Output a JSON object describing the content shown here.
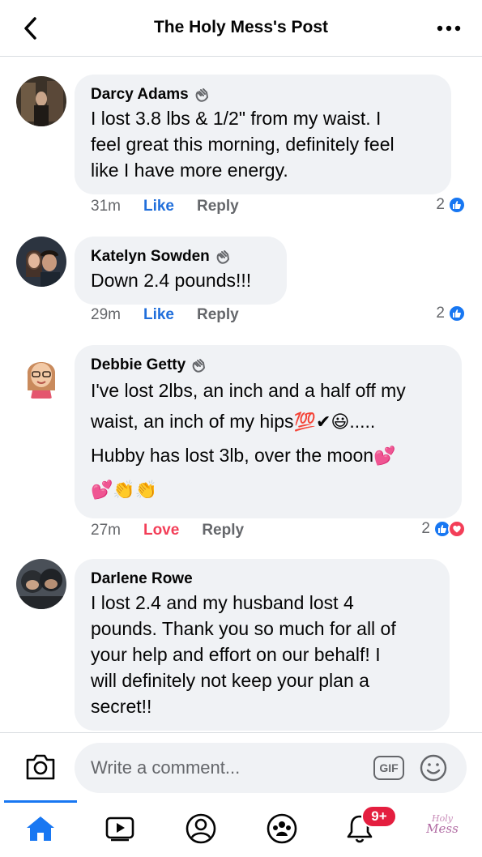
{
  "header": {
    "title": "The Holy Mess's Post"
  },
  "comments": [
    {
      "author": "Darcy Adams",
      "lines": [
        "I lost 3.8 lbs & 1/2\" from my waist. I",
        "feel great this morning, definitely feel",
        "like I have more energy."
      ],
      "time": "31m",
      "action": "Like",
      "reply": "Reply",
      "reaction_count": "2",
      "reactions": [
        "like"
      ]
    },
    {
      "author": "Katelyn Sowden",
      "lines": [
        "Down 2.4 pounds!!!"
      ],
      "time": "29m",
      "action": "Like",
      "reply": "Reply",
      "reaction_count": "2",
      "reactions": [
        "like"
      ]
    },
    {
      "author": "Debbie Getty",
      "line1": "I've lost 2lbs, an inch and a half off my",
      "line2_text": "waist, an inch of my hips",
      "line2_emoji": "💯✔😃",
      "line2_tail": ".....",
      "line3_text": "Hubby has lost 3lb, over the moon",
      "line3_emoji": "💕",
      "line4_emoji": "💕👏👏",
      "time": "27m",
      "action": "Love",
      "reply": "Reply",
      "reaction_count": "2",
      "reactions": [
        "like",
        "love"
      ]
    },
    {
      "author": "Darlene Rowe",
      "lines": [
        "I lost 2.4 and my husband lost 4",
        "pounds. Thank you so much for all of",
        "your help and effort on our behalf! I",
        "will definitely not keep your plan a",
        "secret!!"
      ]
    }
  ],
  "composer": {
    "placeholder": "Write a comment...",
    "gif_label": "GIF"
  },
  "tabbar": {
    "notification_badge": "9+",
    "page_logo_line1": "Holy",
    "page_logo_line2": "Mess"
  },
  "colors": {
    "link_blue": "#216fdb",
    "love_red": "#f33e58",
    "bubble_gray": "#f0f2f5",
    "brand_blue": "#1877f2"
  }
}
